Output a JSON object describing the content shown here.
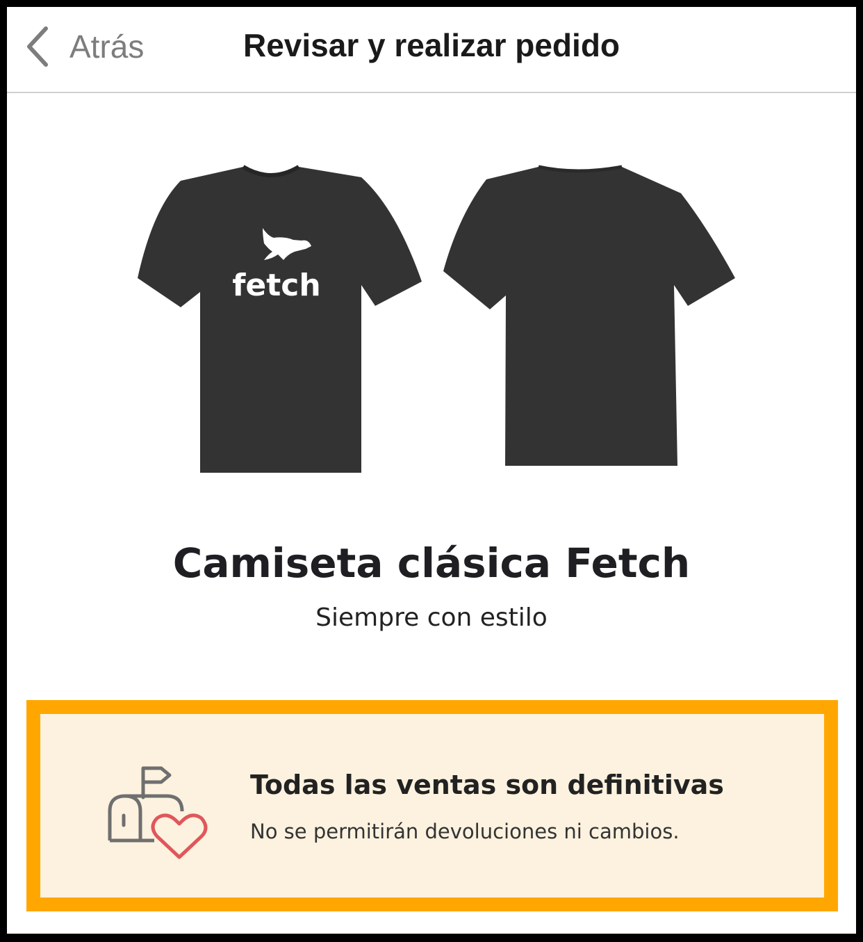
{
  "header": {
    "back_label": "Atrás",
    "title": "Revisar y realizar pedido"
  },
  "product": {
    "image_icon": "tshirt-front-back-image",
    "logo_text": "fetch",
    "title": "Camiseta clásica Fetch",
    "subtitle": "Siempre con estilo"
  },
  "notice": {
    "icon": "mailbox-heart-icon",
    "title": "Todas las ventas son definitivas",
    "text": "No se permitirán devoluciones ni cambios."
  },
  "colors": {
    "accent_border": "#ffa700",
    "notice_background": "#fcf2df",
    "heart": "#e0575b",
    "icon_gray": "#6f6f6f",
    "shirt": "#333333"
  }
}
